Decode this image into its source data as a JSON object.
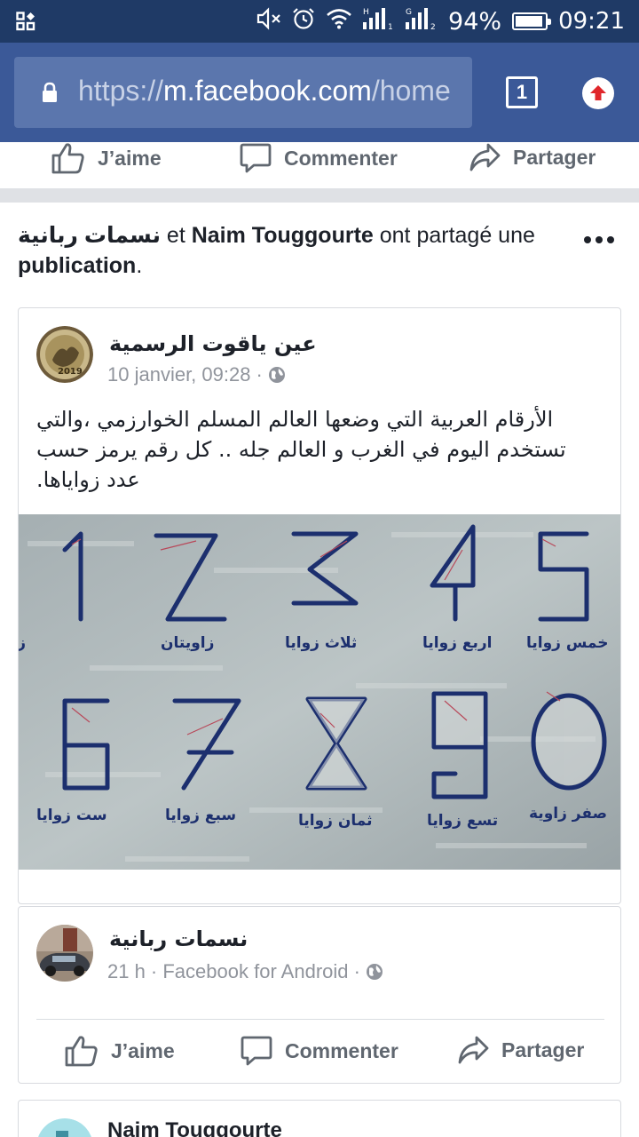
{
  "status_bar": {
    "battery_pct": "94%",
    "battery_fill": 0.94,
    "time": "09:21",
    "icons": [
      "screenshot-icon",
      "mute-icon",
      "alarm-icon",
      "wifi-icon",
      "signal-h-icon",
      "signal-g-icon"
    ]
  },
  "browser": {
    "url_scheme": "https://",
    "url_host": "m.facebook.com",
    "url_path": "/home",
    "tab_count": "1"
  },
  "top_actions": {
    "like": "J’aime",
    "comment": "Commenter",
    "share": "Partager"
  },
  "story": {
    "actor1": "نسمات ربانية",
    "and_word": " et ",
    "actor2": "Naim Touggourte",
    "verb": " ont partagé une ",
    "object": "publication",
    "period": "."
  },
  "shared_post": {
    "page_name": "عين ياقوت الرسمية",
    "date": "10 janvier, 09:28",
    "sep": "·",
    "text": "الأرقام العربية التي وضعها العالم المسلم الخوارزمي ،والتي تستخدم اليوم في الغرب و العالم جله .. كل رقم يرمز حسب عدد زواياها."
  },
  "sharer_post": {
    "name": "نسمات ربانية",
    "meta": "21 h · Facebook for Android ·",
    "like": "J’aime",
    "comment": "Commenter",
    "share": "Partager"
  },
  "next_post": {
    "name": "Naim Touggourte"
  },
  "colors": {
    "status_bar": "#1f3a66",
    "browser_bar": "#3b5998",
    "url_box": "#5b76ad",
    "upload_red": "#e0262b",
    "muted_text": "#90949c"
  }
}
